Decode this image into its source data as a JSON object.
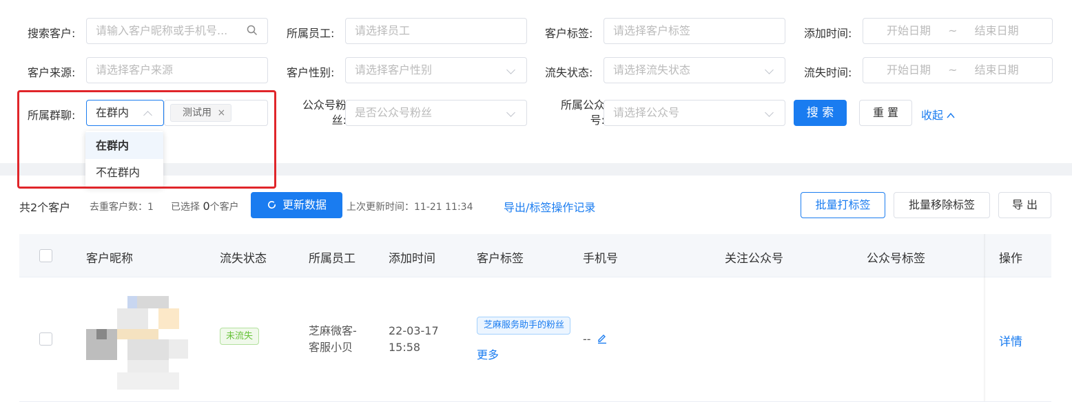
{
  "filters": {
    "search": {
      "label": "搜索客户:",
      "placeholder": "请输入客户昵称或手机号..."
    },
    "staff": {
      "label": "所属员工:",
      "placeholder": "请选择员工"
    },
    "tag": {
      "label": "客户标签:",
      "placeholder": "请选择客户标签"
    },
    "add_time": {
      "label": "添加时间:",
      "start": "开始日期",
      "sep": "~",
      "end": "结束日期"
    },
    "source": {
      "label": "客户来源:",
      "placeholder": "请选择客户来源"
    },
    "gender": {
      "label": "客户性别:",
      "placeholder": "请选择客户性别"
    },
    "churn": {
      "label": "流失状态:",
      "placeholder": "请选择流失状态"
    },
    "churn_time": {
      "label": "流失时间:",
      "start": "开始日期",
      "sep": "~",
      "end": "结束日期"
    },
    "group": {
      "label": "所属群聊:",
      "value": "在群内",
      "chip": "测试用"
    },
    "mp_fan": {
      "label_line1": "公众号粉",
      "label_line2": "丝:",
      "placeholder": "是否公众号粉丝"
    },
    "mp": {
      "label_line1": "所属公众",
      "label_line2": "号:",
      "placeholder": "请选择公众号"
    },
    "search_btn": "搜 索",
    "reset_btn": "重 置",
    "collapse": "收起"
  },
  "dropdown": {
    "options": [
      "在群内",
      "不在群内"
    ],
    "selected": "在群内"
  },
  "toolbar": {
    "total": "共2个客户",
    "dedup": "去重客户数：1",
    "selected_prefix": "已选择",
    "selected_count": "0",
    "selected_suffix": "个客户",
    "update_btn": "更新数据",
    "last_update": "上次更新时间：11-21 11:34",
    "export_log": "导出/标签操作记录",
    "batch_tag": "批量打标签",
    "batch_remove": "批量移除标签",
    "export": "导 出"
  },
  "table": {
    "headers": [
      "客户昵称",
      "流失状态",
      "所属员工",
      "添加时间",
      "客户标签",
      "手机号",
      "关注公众号",
      "公众号标签",
      "操作"
    ],
    "rows": [
      {
        "status": "未流失",
        "staff_line1": "芝麻微客-",
        "staff_line2": "客服小贝",
        "date": "22-03-17",
        "time": "15:58",
        "tag": "芝麻服务助手的粉丝",
        "more": "更多",
        "phone": "--",
        "action": "详情"
      }
    ]
  },
  "colors": {
    "primary": "#1a7cf0",
    "highlight_border": "#e0252a",
    "success": "#67c23a"
  }
}
